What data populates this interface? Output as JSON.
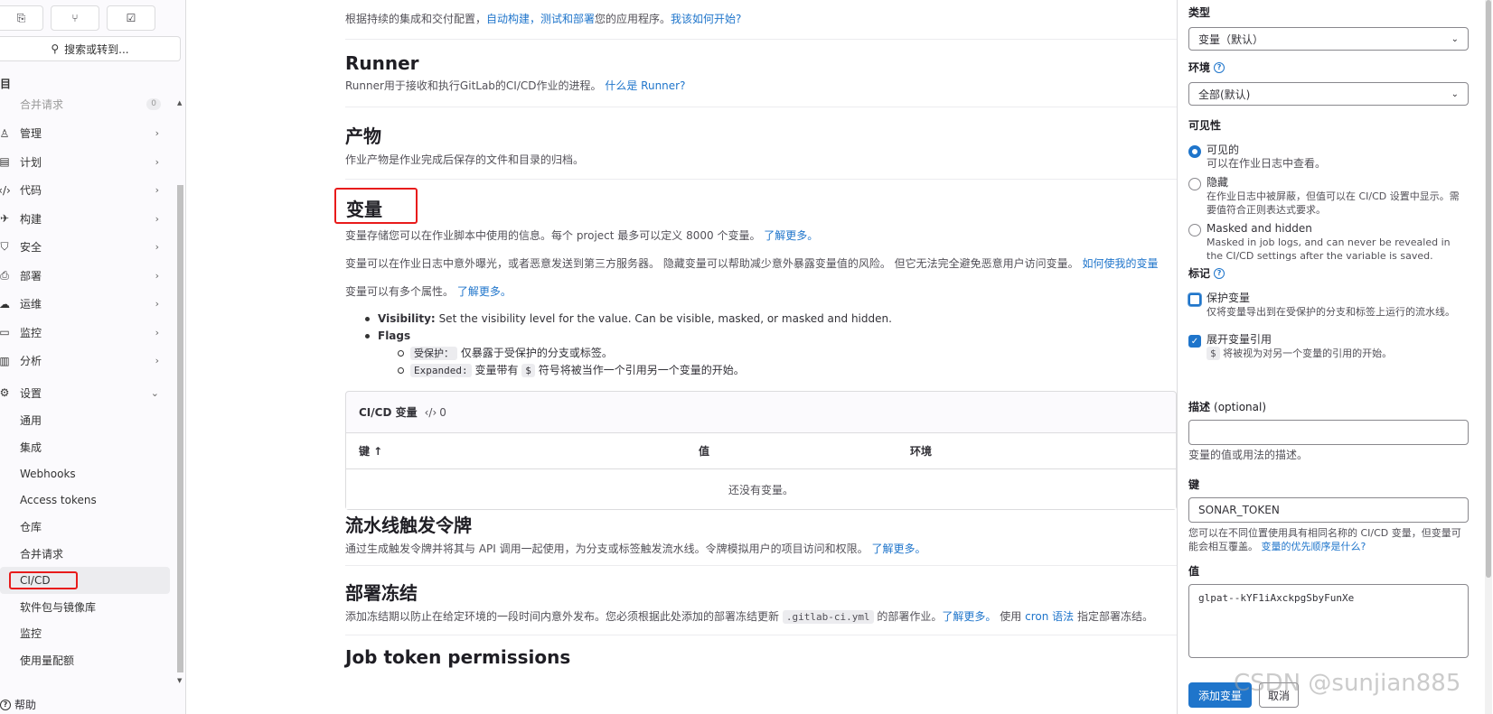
{
  "sidebar": {
    "search_label": "搜索或转到...",
    "section_title": "项目",
    "items": [
      {
        "label": "合并请求",
        "count": "0"
      },
      {
        "label": "管理"
      },
      {
        "label": "计划"
      },
      {
        "label": "代码"
      },
      {
        "label": "构建"
      },
      {
        "label": "安全"
      },
      {
        "label": "部署"
      },
      {
        "label": "运维"
      },
      {
        "label": "监控"
      },
      {
        "label": "分析"
      },
      {
        "label": "设置"
      }
    ],
    "settings_sub": [
      "通用",
      "集成",
      "Webhooks",
      "Access tokens",
      "仓库",
      "合并请求",
      "CI/CD",
      "软件包与镜像库",
      "监控",
      "使用量配额"
    ],
    "help_label": "帮助"
  },
  "main": {
    "intro_text": "根据持续的集成和交付配置，",
    "intro_link1": "自动构建，测试和部署",
    "intro_text2": "您的应用程序。",
    "intro_link2": "我该如何开始?",
    "runner": {
      "title": "Runner",
      "desc": "Runner用于接收和执行GitLab的CI/CD作业的进程。",
      "link": "什么是 Runner?"
    },
    "artifacts": {
      "title": "产物",
      "desc": "作业产物是作业完成后保存的文件和目录的归档。"
    },
    "variables": {
      "title": "变量",
      "desc1": "变量存储您可以在作业脚本中使用的信息。每个 project 最多可以定义 8000 个变量。",
      "desc1_link": "了解更多。",
      "desc2": "变量可以在作业日志中意外曝光，或者恶意发送到第三方服务器。 隐藏变量可以帮助减少意外暴露变量值的风险。 但它无法完全避免恶意用户访问变量。",
      "desc2_link": "如何使我的变量",
      "desc3": "变量可以有多个属性。",
      "desc3_link": "了解更多。",
      "bullet1_bold": "Visibility:",
      "bullet1_text": "Set the visibility level for the value. Can be visible, masked, or masked and hidden.",
      "bullet2_bold": "Flags",
      "sub1_code": "受保护：",
      "sub1_text": "仅暴露于受保护的分支或标签。",
      "sub2_code": "Expanded:",
      "sub2_text1": "变量带有",
      "sub2_code2": "$",
      "sub2_text2": "符号将被当作一个引用另一个变量的开始。",
      "card_title": "CI/CD 变量",
      "card_count": "0",
      "col_key": "键 ↑",
      "col_value": "值",
      "col_env": "环境",
      "empty": "还没有变量。"
    },
    "triggers": {
      "title": "流水线触发令牌",
      "desc": "通过生成触发令牌并将其与 API 调用一起使用，为分支或标签触发流水线。令牌模拟用户的项目访问和权限。",
      "link": "了解更多。"
    },
    "freeze": {
      "title": "部署冻结",
      "desc1": "添加冻结期以防止在给定环境的一段时间内意外发布。您必须根据此处添加的部署冻结更新",
      "code": ".gitlab-ci.yml",
      "desc2": "的部署作业。",
      "link1": "了解更多。",
      "desc3": "使用",
      "link2": "cron 语法",
      "desc4": "指定部署冻结。"
    },
    "job_token": {
      "title": "Job token permissions"
    }
  },
  "drawer": {
    "type_label": "类型",
    "type_value": "变量（默认）",
    "env_label": "环境",
    "env_value": "全部(默认)",
    "visibility_label": "可见性",
    "radio_visible": "可见的",
    "radio_visible_sub": "可以在作业日志中查看。",
    "radio_masked": "隐藏",
    "radio_masked_sub": "在作业日志中被屏蔽，但值可以在 CI/CD 设置中显示。需要值符合正则表达式要求。",
    "radio_hidden": "Masked and hidden",
    "radio_hidden_sub": "Masked in job logs, and can never be revealed in the CI/CD settings after the variable is saved.",
    "flags_label": "标记",
    "protect_label": "保护变量",
    "protect_sub": "仅将变量导出到在受保护的分支和标签上运行的流水线。",
    "expand_label": "展开变量引用",
    "expand_code": "$",
    "expand_sub": "将被视为对另一个变量的引用的开始。",
    "desc_label": "描述",
    "desc_optional": "(optional)",
    "desc_hint": "变量的值或用法的描述。",
    "key_label": "键",
    "key_value": "SONAR_TOKEN",
    "key_hint": "您可以在不同位置使用具有相同名称的 CI/CD 变量，但变量可能会相互覆盖。",
    "key_hint_link": "变量的优先顺序是什么?",
    "value_label": "值",
    "value_value": "glpat--kYF1iAxckpgSbyFunXe",
    "submit": "添加变量",
    "cancel": "取消"
  },
  "watermark": "CSDN @sunjian885",
  "colors": {
    "accent": "#1f75cb",
    "highlight_red": "#e81b1b"
  }
}
